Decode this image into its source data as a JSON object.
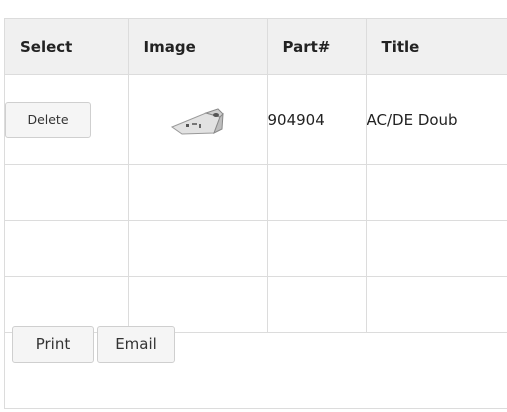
{
  "table": {
    "headers": {
      "select": "Select",
      "image": "Image",
      "part": "Part#",
      "title": "Title"
    },
    "rows": [
      {
        "delete_label": "Delete",
        "image_icon": "part-thumbnail-image",
        "part_number": "904904",
        "title": "AC/DE Doub"
      }
    ],
    "empty_rows": 3
  },
  "footer": {
    "print_label": "Print",
    "email_label": "Email"
  },
  "colors": {
    "header_bg": "#f0f0f0",
    "border": "#dcdcdc",
    "button_bg": "#f5f5f5"
  }
}
